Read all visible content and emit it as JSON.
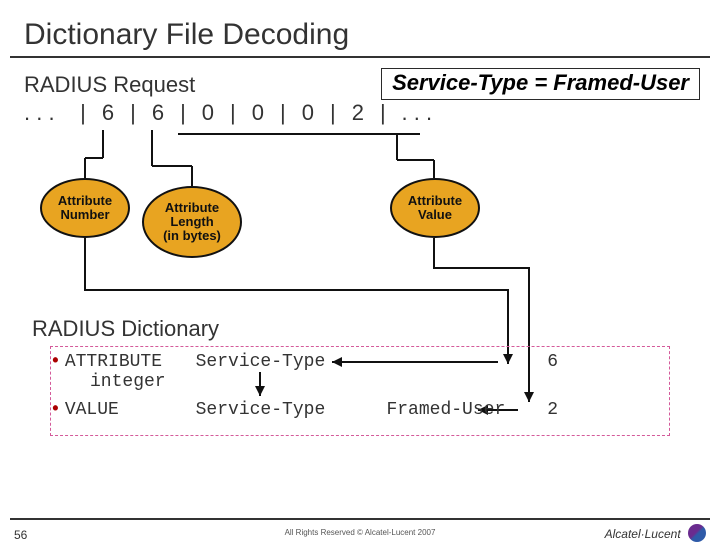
{
  "title": "Dictionary File Decoding",
  "request_label": "RADIUS Request",
  "service_callout": "Service-Type = Framed-User",
  "bytes": {
    "lead": ". . .",
    "b0": "6",
    "b1": "6",
    "b2": "0",
    "b3": "0",
    "b4": "0",
    "b5": "2",
    "trail": ". . ."
  },
  "bubbles": {
    "attr_number": {
      "l1": "Attribute",
      "l2": "Number"
    },
    "attr_length": {
      "l1": "Attribute",
      "l2": "Length",
      "l3": "(in bytes)"
    },
    "attr_value": {
      "l1": "Attribute",
      "l2": "Value"
    }
  },
  "dictionary": {
    "label": "RADIUS Dictionary",
    "row1": {
      "kw": "ATTRIBUTE",
      "name": "Service-Type",
      "num": "6",
      "type": "integer"
    },
    "row2": {
      "kw": "VALUE",
      "name": "Service-Type",
      "enum": "Framed-User",
      "num": "2"
    }
  },
  "footer": {
    "page": "56",
    "copyright": "All Rights Reserved © Alcatel-Lucent 2007",
    "brand": "Alcatel·Lucent"
  },
  "chart_data": {
    "type": "table",
    "title": "RADIUS attribute decoding via dictionary",
    "packet_bytes": [
      6,
      6,
      0,
      0,
      0,
      2
    ],
    "fields": [
      {
        "name": "Attribute Number",
        "bytes": [
          6
        ],
        "decoded": "Service-Type"
      },
      {
        "name": "Attribute Length (in bytes)",
        "bytes": [
          6
        ]
      },
      {
        "name": "Attribute Value",
        "bytes": [
          0,
          0,
          0,
          2
        ],
        "decoded": "Framed-User"
      }
    ],
    "dictionary_entries": [
      {
        "kind": "ATTRIBUTE",
        "name": "Service-Type",
        "id": 6,
        "type": "integer"
      },
      {
        "kind": "VALUE",
        "attribute": "Service-Type",
        "name": "Framed-User",
        "id": 2
      }
    ],
    "result": "Service-Type = Framed-User"
  }
}
